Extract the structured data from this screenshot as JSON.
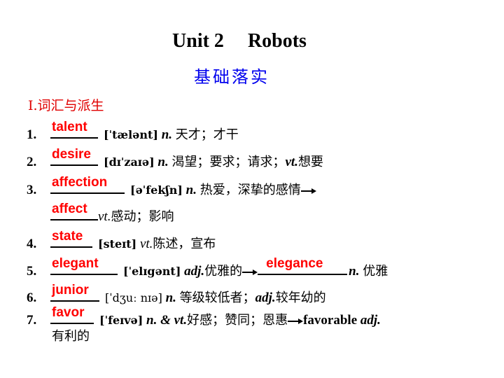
{
  "header": {
    "unit": "Unit 2",
    "topic": "Robots",
    "subtitle": "基础落实"
  },
  "section": {
    "title": "Ⅰ.词汇与派生"
  },
  "items": [
    {
      "num": "1.",
      "answer": "talent",
      "ipa": "[ˈtælənt]",
      "pos": "n.",
      "meaning": "天才；才干"
    },
    {
      "num": "2.",
      "answer": "desire",
      "ipa": "[dɪˈzaɪə]",
      "pos": "n.",
      "meaning": "渴望；要求；请求；",
      "pos2": "vt.",
      "meaning2": "想要"
    },
    {
      "num": "3.",
      "answer": "affection",
      "ipa": "[əˈfekʃn]",
      "pos": "n.",
      "meaning": "热爱，深挚的感情",
      "derived_answer": "affect",
      "derived_pos": "vt.",
      "derived_meaning": "感动；影响"
    },
    {
      "num": "4.",
      "answer": "state",
      "ipa": "[steɪt]",
      "pos": "vt.",
      "meaning": "陈述，宣布"
    },
    {
      "num": "5.",
      "answer": "elegant",
      "ipa": "[ˈelɪgənt]",
      "pos": "adj.",
      "meaning": "优雅的",
      "derived_answer": "elegance",
      "derived_pos": "n.",
      "derived_meaning": "优雅"
    },
    {
      "num": "6.",
      "answer": "junior",
      "ipa": "[ˈdʒuː  nɪə]",
      "pos": "n.",
      "meaning": "等级较低者；",
      "pos2": "adj.",
      "meaning2": "较年幼的"
    },
    {
      "num": "7.",
      "answer": "favor",
      "ipa": "[ˈfeɪvə]",
      "pos": "n. & vt.",
      "meaning": "好感；赞同；恩惠",
      "derived_word": "favorable",
      "derived_pos": "adj.",
      "derived_meaning": "有利的"
    }
  ]
}
